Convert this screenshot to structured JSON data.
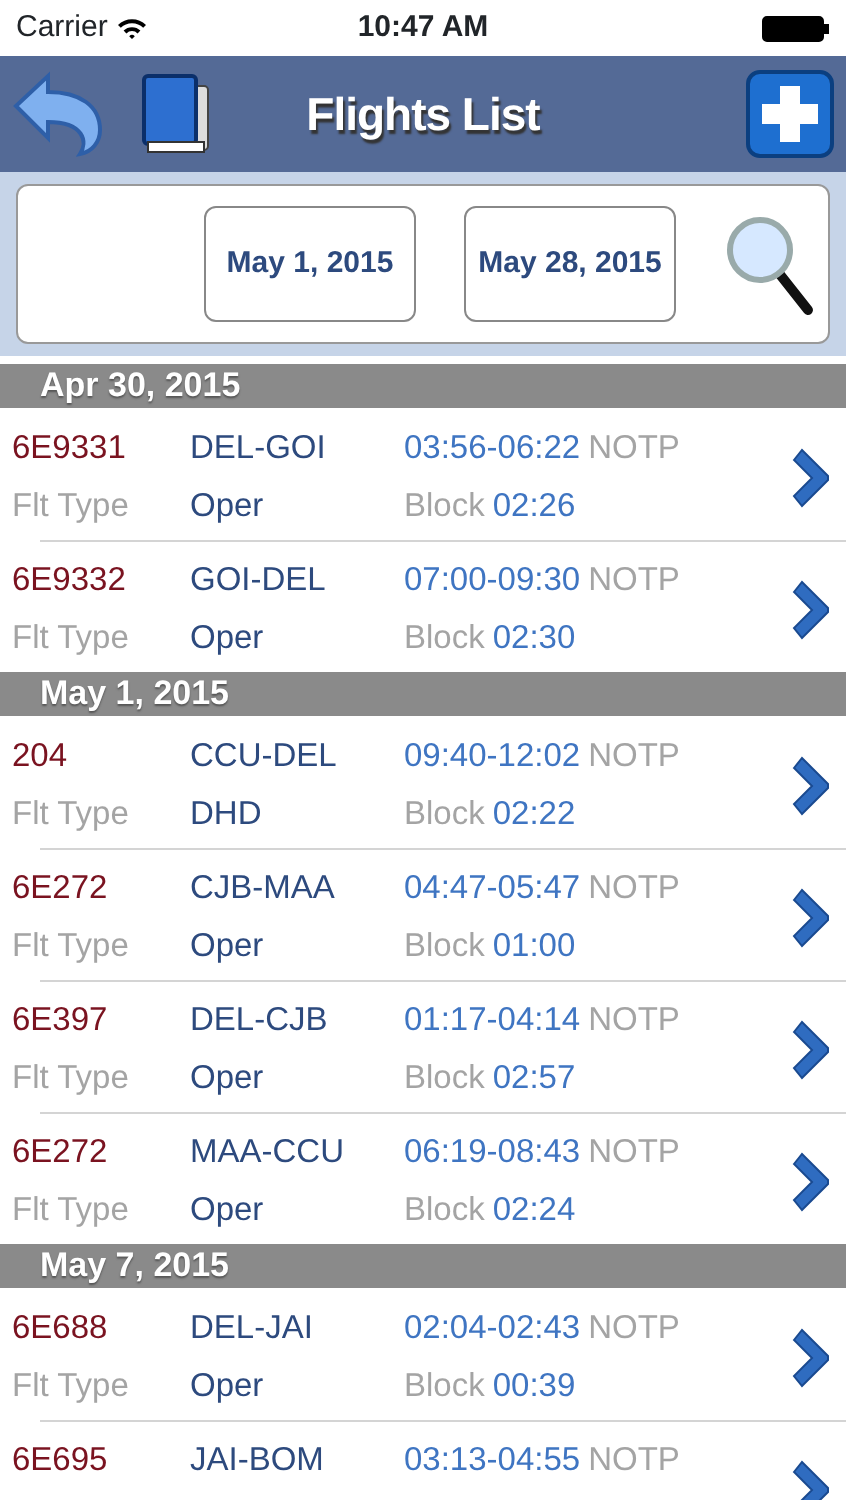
{
  "status_bar": {
    "carrier": "Carrier",
    "time": "10:47 AM"
  },
  "nav_bar": {
    "title": "Flights List"
  },
  "filter": {
    "from_date": "May 1, 2015",
    "to_date": "May 28, 2015"
  },
  "sections": [
    {
      "date": "Apr 30, 2015",
      "flights": [
        {
          "flight": "6E9331",
          "route": "DEL-GOI",
          "times": "03:56-06:22",
          "status": "NOTP",
          "type_label": "Flt Type",
          "type": "Oper",
          "block_label": "Block",
          "block": "02:26"
        },
        {
          "flight": "6E9332",
          "route": "GOI-DEL",
          "times": "07:00-09:30",
          "status": "NOTP",
          "type_label": "Flt Type",
          "type": "Oper",
          "block_label": "Block",
          "block": "02:30"
        }
      ]
    },
    {
      "date": "May 1, 2015",
      "flights": [
        {
          "flight": "204",
          "route": "CCU-DEL",
          "times": "09:40-12:02",
          "status": "NOTP",
          "type_label": "Flt Type",
          "type": "DHD",
          "block_label": "Block",
          "block": "02:22"
        },
        {
          "flight": "6E272",
          "route": "CJB-MAA",
          "times": "04:47-05:47",
          "status": "NOTP",
          "type_label": "Flt Type",
          "type": "Oper",
          "block_label": "Block",
          "block": "01:00"
        },
        {
          "flight": "6E397",
          "route": "DEL-CJB",
          "times": "01:17-04:14",
          "status": "NOTP",
          "type_label": "Flt Type",
          "type": "Oper",
          "block_label": "Block",
          "block": "02:57"
        },
        {
          "flight": "6E272",
          "route": "MAA-CCU",
          "times": "06:19-08:43",
          "status": "NOTP",
          "type_label": "Flt Type",
          "type": "Oper",
          "block_label": "Block",
          "block": "02:24"
        }
      ]
    },
    {
      "date": "May 7, 2015",
      "flights": [
        {
          "flight": "6E688",
          "route": "DEL-JAI",
          "times": "02:04-02:43",
          "status": "NOTP",
          "type_label": "Flt Type",
          "type": "Oper",
          "block_label": "Block",
          "block": "00:39"
        },
        {
          "flight": "6E695",
          "route": "JAI-BOM",
          "times": "03:13-04:55",
          "status": "NOTP"
        }
      ]
    }
  ]
}
